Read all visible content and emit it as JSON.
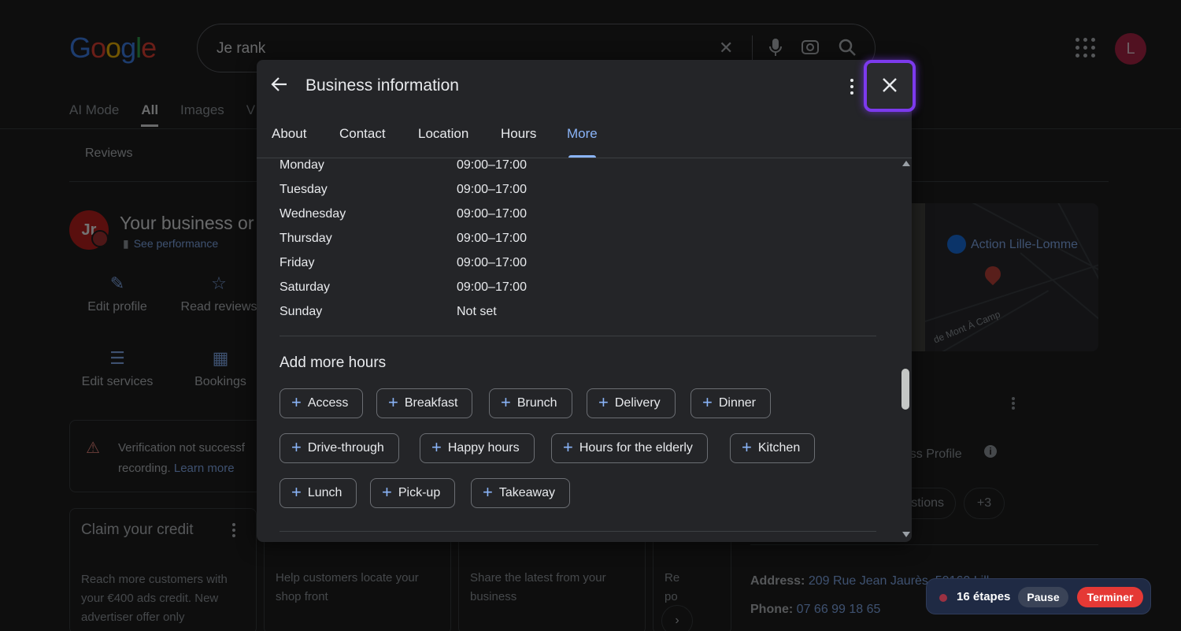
{
  "background": {
    "logo_letters": [
      "G",
      "o",
      "o",
      "g",
      "l",
      "e"
    ],
    "search_query": "Je rank",
    "nav_tabs": [
      "AI Mode",
      "All",
      "Images",
      "V"
    ],
    "active_tab": "All",
    "reviews_chip": "Reviews",
    "business_initials": "Jr",
    "business_title": "Your business or",
    "see_performance": "See performance",
    "actions": {
      "edit_profile": "Edit profile",
      "read_reviews": "Read reviews",
      "edit_services": "Edit services",
      "bookings": "Bookings"
    },
    "warning": {
      "text": "Verification not successf recording.",
      "link": "Learn more"
    },
    "cards": [
      {
        "title": "Claim your credit",
        "body": "Reach more customers with your €400 ads credit. New advertiser offer only"
      },
      {
        "title": "",
        "body": "Help customers locate your shop front"
      },
      {
        "title": "",
        "body": "Share the latest from your business"
      },
      {
        "title": "",
        "body": "Re po"
      }
    ],
    "map": {
      "poi": "Action Lille-Lomme",
      "street": "de Mont À Camp"
    },
    "profile_label": "ness Profile",
    "chips": [
      "stions",
      "+3"
    ],
    "address_label": "Address:",
    "address_value": "209 Rue Jean Jaurès, 59160 Lill",
    "phone_label": "Phone:",
    "phone_value": "07 66 99 18 65",
    "avatar_letter": "L"
  },
  "modal": {
    "title": "Business information",
    "tabs": [
      "About",
      "Contact",
      "Location",
      "Hours",
      "More"
    ],
    "active_tab": "More",
    "hours": [
      {
        "day": "Monday",
        "value": "09:00–17:00"
      },
      {
        "day": "Tuesday",
        "value": "09:00–17:00"
      },
      {
        "day": "Wednesday",
        "value": "09:00–17:00"
      },
      {
        "day": "Thursday",
        "value": "09:00–17:00"
      },
      {
        "day": "Friday",
        "value": "09:00–17:00"
      },
      {
        "day": "Saturday",
        "value": "09:00–17:00"
      },
      {
        "day": "Sunday",
        "value": "Not set"
      }
    ],
    "add_more_hours_heading": "Add more hours",
    "hour_types": [
      "Access",
      "Breakfast",
      "Brunch",
      "Delivery",
      "Dinner",
      "Drive-through",
      "Happy hours",
      "Hours for the elderly",
      "Kitchen",
      "Lunch",
      "Pick-up",
      "Takeaway"
    ]
  },
  "close_button_icon": "close-icon",
  "controller": {
    "steps": "16 étapes",
    "pause": "Pause",
    "stop": "Terminer"
  },
  "colors": {
    "accent": "#8ab4f8",
    "highlight": "#7c3aed",
    "stop": "#e53935"
  }
}
